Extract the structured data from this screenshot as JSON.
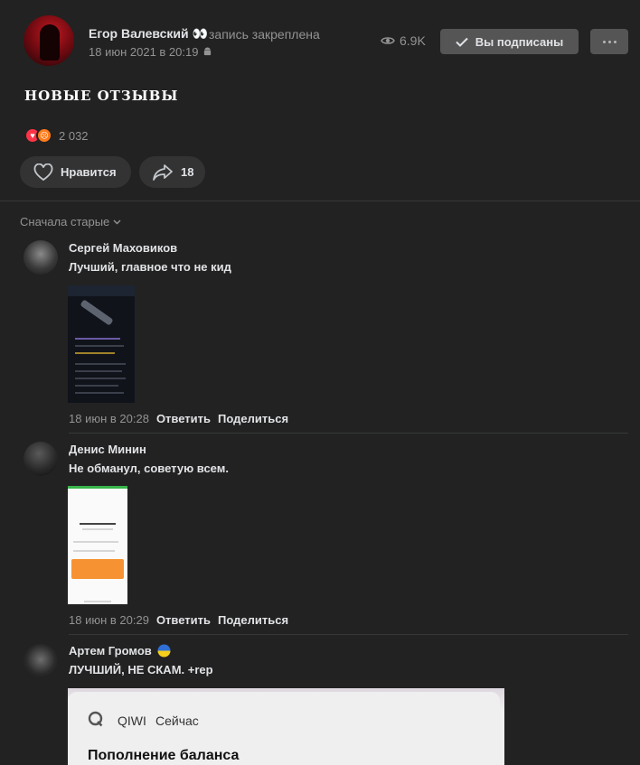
{
  "post": {
    "author_name": "Егор Валевский 👀",
    "pinned_label": "запись закреплена",
    "date": "18 июн 2021 в 20:19",
    "views": "6.9K",
    "subscribe_label": "Вы подписаны",
    "text": "новые отзывы",
    "reactions_count": "2 032",
    "like_label": "Нравится",
    "share_count": "18"
  },
  "comments_sort": "Сначала старые",
  "comments": [
    {
      "name": "Сергей Маховиков",
      "text": "Лучший, главное что не кид",
      "date": "18 июн в 20:28",
      "reply": "Ответить",
      "share": "Поделиться"
    },
    {
      "name": "Денис Минин",
      "text": "Не обманул, советую всем.",
      "date": "18 июн в 20:29",
      "reply": "Ответить",
      "share": "Поделиться"
    },
    {
      "name": "Артем Громов",
      "text": "ЛУЧШИЙ, НЕ СКАМ. +rep"
    }
  ],
  "qiwi_notification": {
    "app": "QIWI",
    "when": "Сейчас",
    "title": "Пополнение баланса"
  },
  "colors": {
    "background": "#222222",
    "button": "#555555",
    "muted_text": "#939393",
    "heart_reaction": "#ff3347",
    "angry_reaction": "#ff7a1a"
  },
  "icons": [
    "eye-icon",
    "check-icon",
    "more-icon",
    "heart-icon",
    "share-icon",
    "android-icon",
    "chevron-down-icon",
    "flag-ukraine-icon",
    "qiwi-logo-icon"
  ]
}
